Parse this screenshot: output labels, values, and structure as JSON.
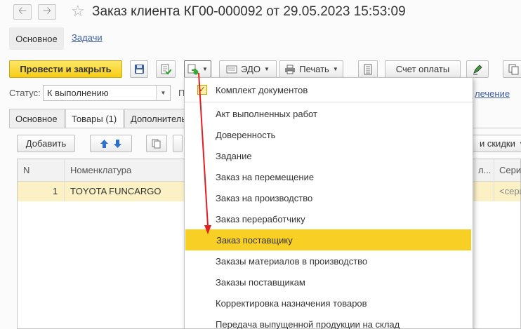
{
  "window": {
    "back_icon": "arrow-left-icon",
    "forward_icon": "arrow-right-icon",
    "favorite_icon": "star-icon",
    "title": "Заказ клиента КГ00-000092 от 29.05.2023 15:53:09"
  },
  "top_tabs": {
    "main": "Основное",
    "tasks": "Задачи"
  },
  "toolbar": {
    "post_close": "Провести и закрыть",
    "save_icon": "floppy-disk-icon",
    "post_icon": "document-post-icon",
    "create_based_icon": "create-based-on-icon",
    "edo": "ЭДО",
    "print": "Печать",
    "report_icon": "report-icon",
    "invoice": "Счет оплаты",
    "pen_icon": "pen-icon",
    "copy_icon": "copy-icon"
  },
  "status": {
    "label": "Статус:",
    "value": "К выполнению",
    "next_label_cut": "П",
    "right_link_cut": "лечение"
  },
  "inner_tabs": [
    "Основное",
    "Товары (1)",
    "Дополнитель"
  ],
  "table_toolbar": {
    "add": "Добавить",
    "up_icon": "arrow-up-icon",
    "down_icon": "arrow-down-icon",
    "copy_icon": "copy-rows-icon",
    "discounts_cut": "и скидки"
  },
  "table": {
    "columns": [
      "N",
      "Номенклатура",
      "л...",
      "Сери"
    ],
    "rows": [
      {
        "n": "1",
        "item": "TOYOTA FUNCARGO",
        "series": "<сери"
      }
    ]
  },
  "menu": {
    "top_item": "Комплект документов",
    "items": [
      "Акт выполненных работ",
      "Доверенность",
      "Задание",
      "Заказ на перемещение",
      "Заказ на производство",
      "Заказ переработчику",
      "Заказ поставщику",
      "Заказы материалов в производство",
      "Заказы поставщикам",
      "Корректировка назначения товаров",
      "Передача выпущенной продукции на склад"
    ],
    "highlighted_index": 6
  },
  "colors": {
    "accent_yellow": "#f8cf24",
    "annotation_red": "#e02020",
    "link_blue": "#4060a8",
    "row_selected": "#fbf1c4"
  }
}
